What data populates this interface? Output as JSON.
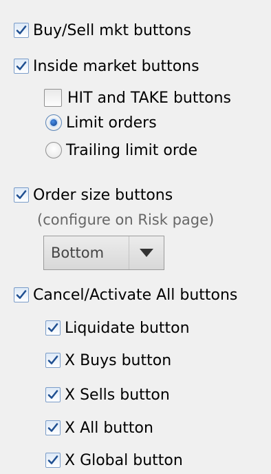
{
  "options": {
    "buy_sell": {
      "label": "Buy/Sell mkt buttons",
      "checked": true
    },
    "inside_market": {
      "label": "Inside market buttons",
      "checked": true
    },
    "hit_take": {
      "label": "HIT and TAKE buttons",
      "checked": false
    },
    "limit_orders": {
      "label": "Limit orders",
      "selected": true
    },
    "trailing_limit": {
      "label": "Trailing limit orde",
      "selected": false
    },
    "order_size": {
      "label": "Order size buttons",
      "checked": true
    },
    "order_size_note": "(configure on Risk page)",
    "position_select": {
      "value": "Bottom"
    },
    "cancel_activate": {
      "label": "Cancel/Activate All buttons",
      "checked": true
    },
    "liquidate": {
      "label": "Liquidate button",
      "checked": true
    },
    "x_buys": {
      "label": "X Buys button",
      "checked": true
    },
    "x_sells": {
      "label": "X Sells button",
      "checked": true
    },
    "x_all": {
      "label": "X All button",
      "checked": true
    },
    "x_global": {
      "label": "X Global button",
      "checked": true
    }
  },
  "colors": {
    "background": "#f0f0f0",
    "check": "#1f4f91",
    "note_text": "#666666"
  }
}
